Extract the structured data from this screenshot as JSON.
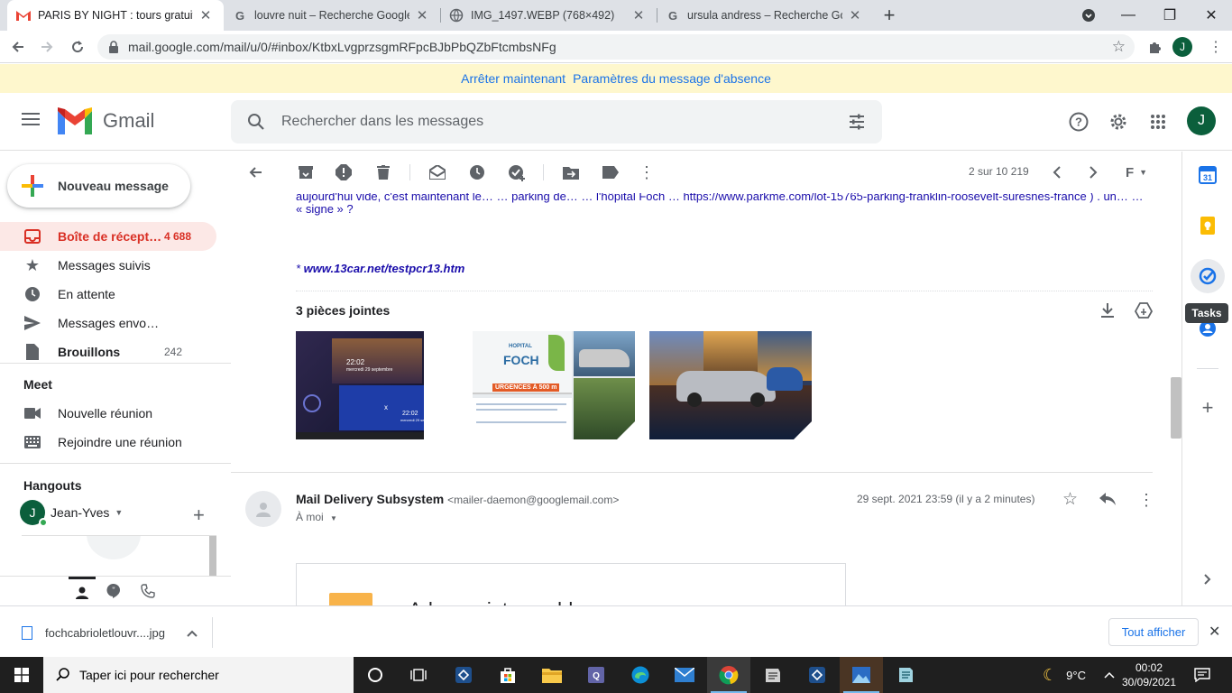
{
  "browser": {
    "tabs": [
      {
        "title": "PARIS BY NIGHT : tours gratuits e",
        "favicon": "gmail-icon",
        "active": true
      },
      {
        "title": "louvre nuit – Recherche Google",
        "favicon": "google-icon",
        "active": false
      },
      {
        "title": "IMG_1497.WEBP (768×492)",
        "favicon": "globe-icon",
        "active": false
      },
      {
        "title": "ursula andress – Recherche Goog",
        "favicon": "google-icon",
        "active": false
      }
    ],
    "url": "mail.google.com/mail/u/0/#inbox/KtbxLvgprzsgmRFpcBJbPbQZbFtcmbsNFg",
    "profile_initial": "J"
  },
  "banner": {
    "stop_label": "Arrêter maintenant",
    "settings_label": "Paramètres du message d'absence"
  },
  "gmail": {
    "brand": "Gmail",
    "search_placeholder": "Rechercher dans les messages",
    "account_initial": "J"
  },
  "sidebar": {
    "compose_label": "Nouveau message",
    "items": [
      {
        "label": "Boîte de récepti…",
        "count": "4 688",
        "icon": "inbox-icon"
      },
      {
        "label": "Messages suivis",
        "count": "",
        "icon": "star-icon"
      },
      {
        "label": "En attente",
        "count": "",
        "icon": "clock-icon"
      },
      {
        "label": "Messages envoyés",
        "count": "",
        "icon": "send-icon"
      },
      {
        "label": "Brouillons",
        "count": "242",
        "icon": "draft-icon"
      }
    ],
    "meet_title": "Meet",
    "meet_items": [
      {
        "label": "Nouvelle réunion",
        "icon": "video-icon"
      },
      {
        "label": "Rejoindre une réunion",
        "icon": "keyboard-icon"
      }
    ],
    "hangouts_title": "Hangouts",
    "hangouts_user": "Jean-Yves",
    "hangouts_initial": "J"
  },
  "message_toolbar": {
    "pager": "2 sur 10 219"
  },
  "message": {
    "cut_text": "aujourd'hui vide, c'est maintenant le… … parking de… … l'hôpital Foch … https://www.parkme.com/lot-15765-parking-franklin-roosevelt-suresnes-france ) . un… …",
    "signe_text": "« signe » ?",
    "link_prefix": "* ",
    "link_text": "www.13car.net/testpcr13.htm",
    "attachments_title": "3 pièces jointes",
    "attachment_labels": {
      "hospital_small": "HOPITAL",
      "hospital_big": "FOCH",
      "urgences": "URGENCES À 500 m"
    },
    "attachment_texts": {
      "clock1_time": "22:02",
      "clock1_date": "mercredi 29 septembre",
      "clock2_time": "22:02",
      "clock2_date": "mercredi 29 septembre",
      "close": "x"
    },
    "sender_name": "Mail Delivery Subsystem",
    "sender_email": "<mailer-daemon@googlemail.com>",
    "to_me": "À moi",
    "date": "29 sept. 2021 23:59 (il y a 2 minutes)",
    "card_text": "Adresse introuvable"
  },
  "side_panel": {
    "tooltip": "Tasks",
    "calendar_day": "31"
  },
  "download": {
    "filename": "fochcabrioletlouvr....jpg",
    "show_all": "Tout afficher"
  },
  "taskbar": {
    "search_placeholder": "Taper ici pour rechercher",
    "temperature": "9°C",
    "time": "00:02",
    "date": "30/09/2021"
  },
  "colors": {
    "gmail_red": "#d93025",
    "link_blue": "#1a73e8",
    "banner_yellow": "#fef7cd",
    "inbox_active_bg": "#fce8e6"
  }
}
